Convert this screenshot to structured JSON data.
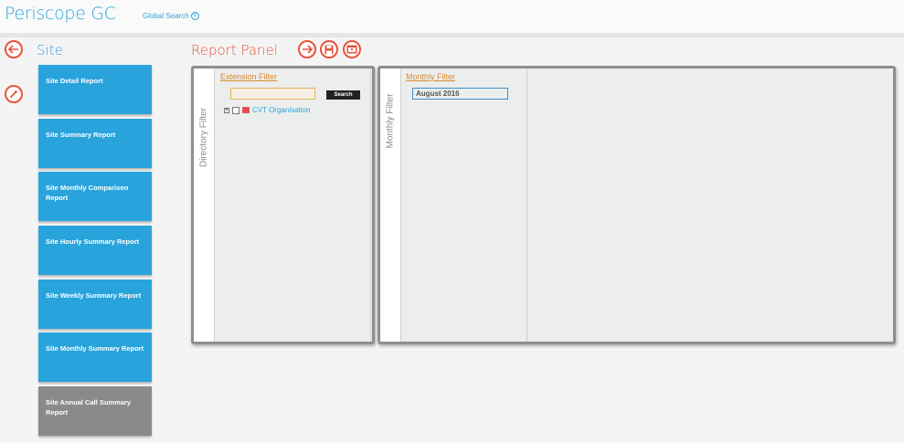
{
  "header": {
    "app_title": "Periscope GC",
    "global_search_label": "Global Search",
    "global_search_icon": "search-icon"
  },
  "sidebar": {
    "heading": "Site",
    "back_icon": "back-arrow-icon",
    "edit_icon": "pencil-icon",
    "reports": [
      {
        "label": "Site Detail Report"
      },
      {
        "label": "Site Summary Report"
      },
      {
        "label": "Site Monthly Comparison Report"
      },
      {
        "label": "Site Hourly Summary Report"
      },
      {
        "label": "Site Weekly Summary Report"
      },
      {
        "label": "Site Monthly Summary Report"
      },
      {
        "label": "Site Annual Call Summary Report"
      }
    ],
    "selected_index": 6
  },
  "report_panel": {
    "heading": "Report Panel",
    "actions": [
      {
        "name": "run-arrow-icon"
      },
      {
        "name": "save-icon"
      },
      {
        "name": "schedule-icon"
      }
    ],
    "directory_filter": {
      "tab_label": "Directory Filter",
      "title": "Extension Filter",
      "input_value": "",
      "search_label": "Search",
      "tree_root": "CVT Organisation"
    },
    "monthly_filter": {
      "tab_label": "Monthly Filter",
      "title": "Monthly Filter",
      "selected_month": "August 2016"
    }
  },
  "colors": {
    "accent_blue": "#29a3dc",
    "accent_orange": "#e8533a",
    "selected_gray": "#8a8a8a",
    "filter_title": "#d98a2b"
  }
}
